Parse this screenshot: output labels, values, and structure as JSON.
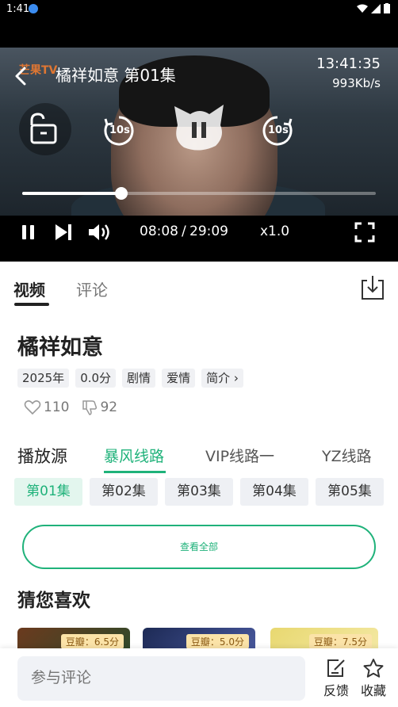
{
  "status_bar": {
    "time": "1:41"
  },
  "player": {
    "title": "橘祥如意 第01集",
    "clock": "13:41:35",
    "net_speed": "993Kb/s",
    "logo_text": "芒果TV",
    "rewind_label": "10s",
    "forward_label": "10s",
    "progress": 0.28,
    "current_time": "08:08",
    "time_separator": "/",
    "total_time": "29:09",
    "speed": "x1.0"
  },
  "tabs": [
    {
      "label": "视频",
      "active": true
    },
    {
      "label": "评论",
      "active": false
    }
  ],
  "show": {
    "title": "橘祥如意",
    "tags": [
      "2025年",
      "0.0分",
      "剧情",
      "爱情",
      "简介 ›"
    ],
    "likes": "110",
    "dislikes": "92"
  },
  "sources": {
    "label": "播放源",
    "routes": [
      "暴风线路",
      "VIP线路一",
      "YZ线路"
    ],
    "active_route": 0
  },
  "episodes": [
    "第01集",
    "第02集",
    "第03集",
    "第04集",
    "第05集"
  ],
  "view_all_label": "查看全部",
  "recommend": {
    "title": "猜您喜欢",
    "cards": [
      {
        "score": "豆瓣：6.5分"
      },
      {
        "score": "豆瓣：5.0分"
      },
      {
        "score": "豆瓣：7.5分"
      }
    ]
  },
  "bottom_bar": {
    "comment_placeholder": "参与评论",
    "feedback_label": "反馈",
    "favorite_label": "收藏"
  },
  "colors": {
    "accent": "#1fb27a",
    "score_badge": "#fbe3a8"
  }
}
